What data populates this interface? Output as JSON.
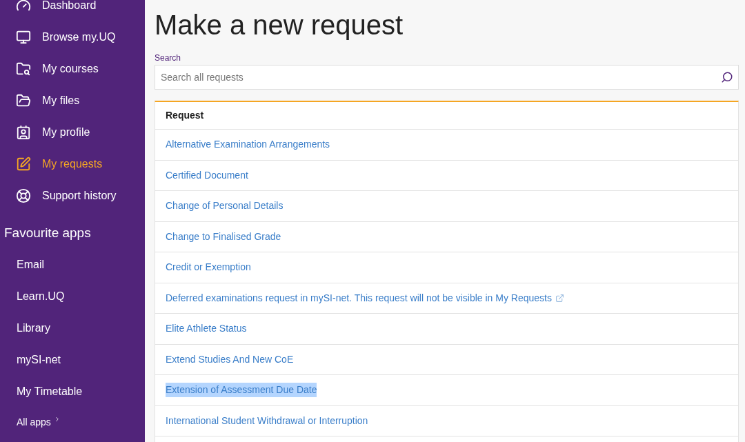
{
  "sidebar": {
    "nav": [
      {
        "label": "Dashboard",
        "selected": false
      },
      {
        "label": "Browse my.UQ",
        "selected": false
      },
      {
        "label": "My courses",
        "selected": false
      },
      {
        "label": "My files",
        "selected": false
      },
      {
        "label": "My profile",
        "selected": false
      },
      {
        "label": "My requests",
        "selected": true
      },
      {
        "label": "Support history",
        "selected": false
      }
    ],
    "favourites_heading": "Favourite apps",
    "favourites": [
      "Email",
      "Learn.UQ",
      "Library",
      "mySI-net",
      "My Timetable"
    ],
    "all_apps": "All apps"
  },
  "main": {
    "title": "Make a new request",
    "search": {
      "label": "Search",
      "placeholder": "Search all requests"
    },
    "table": {
      "column": "Request",
      "rows": [
        {
          "text": "Alternative Examination Arrangements",
          "external": false,
          "highlighted": false
        },
        {
          "text": "Certified Document",
          "external": false,
          "highlighted": false
        },
        {
          "text": "Change of Personal Details",
          "external": false,
          "highlighted": false
        },
        {
          "text": "Change to Finalised Grade",
          "external": false,
          "highlighted": false
        },
        {
          "text": "Credit or Exemption",
          "external": false,
          "highlighted": false
        },
        {
          "text": "Deferred examinations request in mySI-net. This request will not be visible in My Requests",
          "external": true,
          "highlighted": false
        },
        {
          "text": "Elite Athlete Status",
          "external": false,
          "highlighted": false
        },
        {
          "text": "Extend Studies And New CoE",
          "external": false,
          "highlighted": false
        },
        {
          "text": "Extension of Assessment Due Date",
          "external": false,
          "highlighted": true
        },
        {
          "text": "International Student Withdrawal or Interruption",
          "external": false,
          "highlighted": false
        }
      ]
    }
  }
}
